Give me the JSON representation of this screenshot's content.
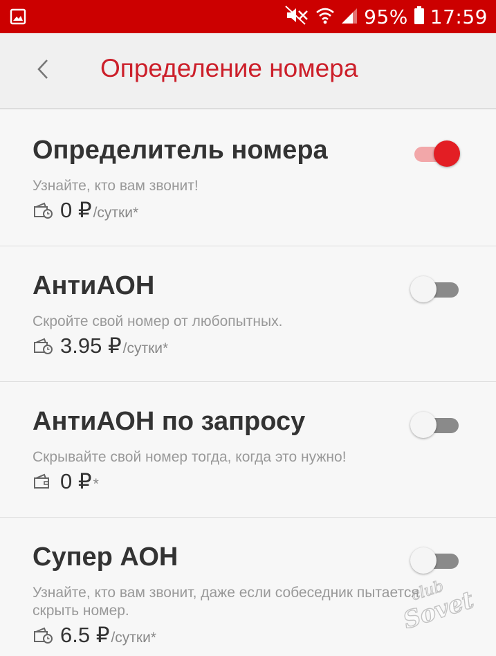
{
  "status_bar": {
    "battery": "95%",
    "time": "17:59",
    "icons": [
      "gallery-icon",
      "mute-icon",
      "wifi-icon",
      "signal-icon",
      "battery-icon"
    ]
  },
  "header": {
    "title": "Определение номера",
    "back_icon": "chevron-left-icon"
  },
  "services": [
    {
      "title": "Определитель номера",
      "subtitle": "Узнайте, кто вам звонит!",
      "price": "0 ₽",
      "period": "/сутки*",
      "enabled": true
    },
    {
      "title": "АнтиАОН",
      "subtitle": "Скройте свой номер от любопытных.",
      "price": "3.95 ₽",
      "period": "/сутки*",
      "enabled": false
    },
    {
      "title": "АнтиАОН по запросу",
      "subtitle": "Скрывайте свой номер тогда, когда это нужно!",
      "price": "0 ₽",
      "period": "*",
      "enabled": false
    },
    {
      "title": "Супер АОН",
      "subtitle": "Узнайте, кто вам звонит, даже если собеседник пытается скрыть номер.",
      "price": "6.5 ₽",
      "period": "/сутки*",
      "enabled": false
    }
  ],
  "colors": {
    "status_bar": "#cc0000",
    "accent": "#e31e24",
    "title": "#cc1f2a"
  },
  "watermark": "club Sovet"
}
